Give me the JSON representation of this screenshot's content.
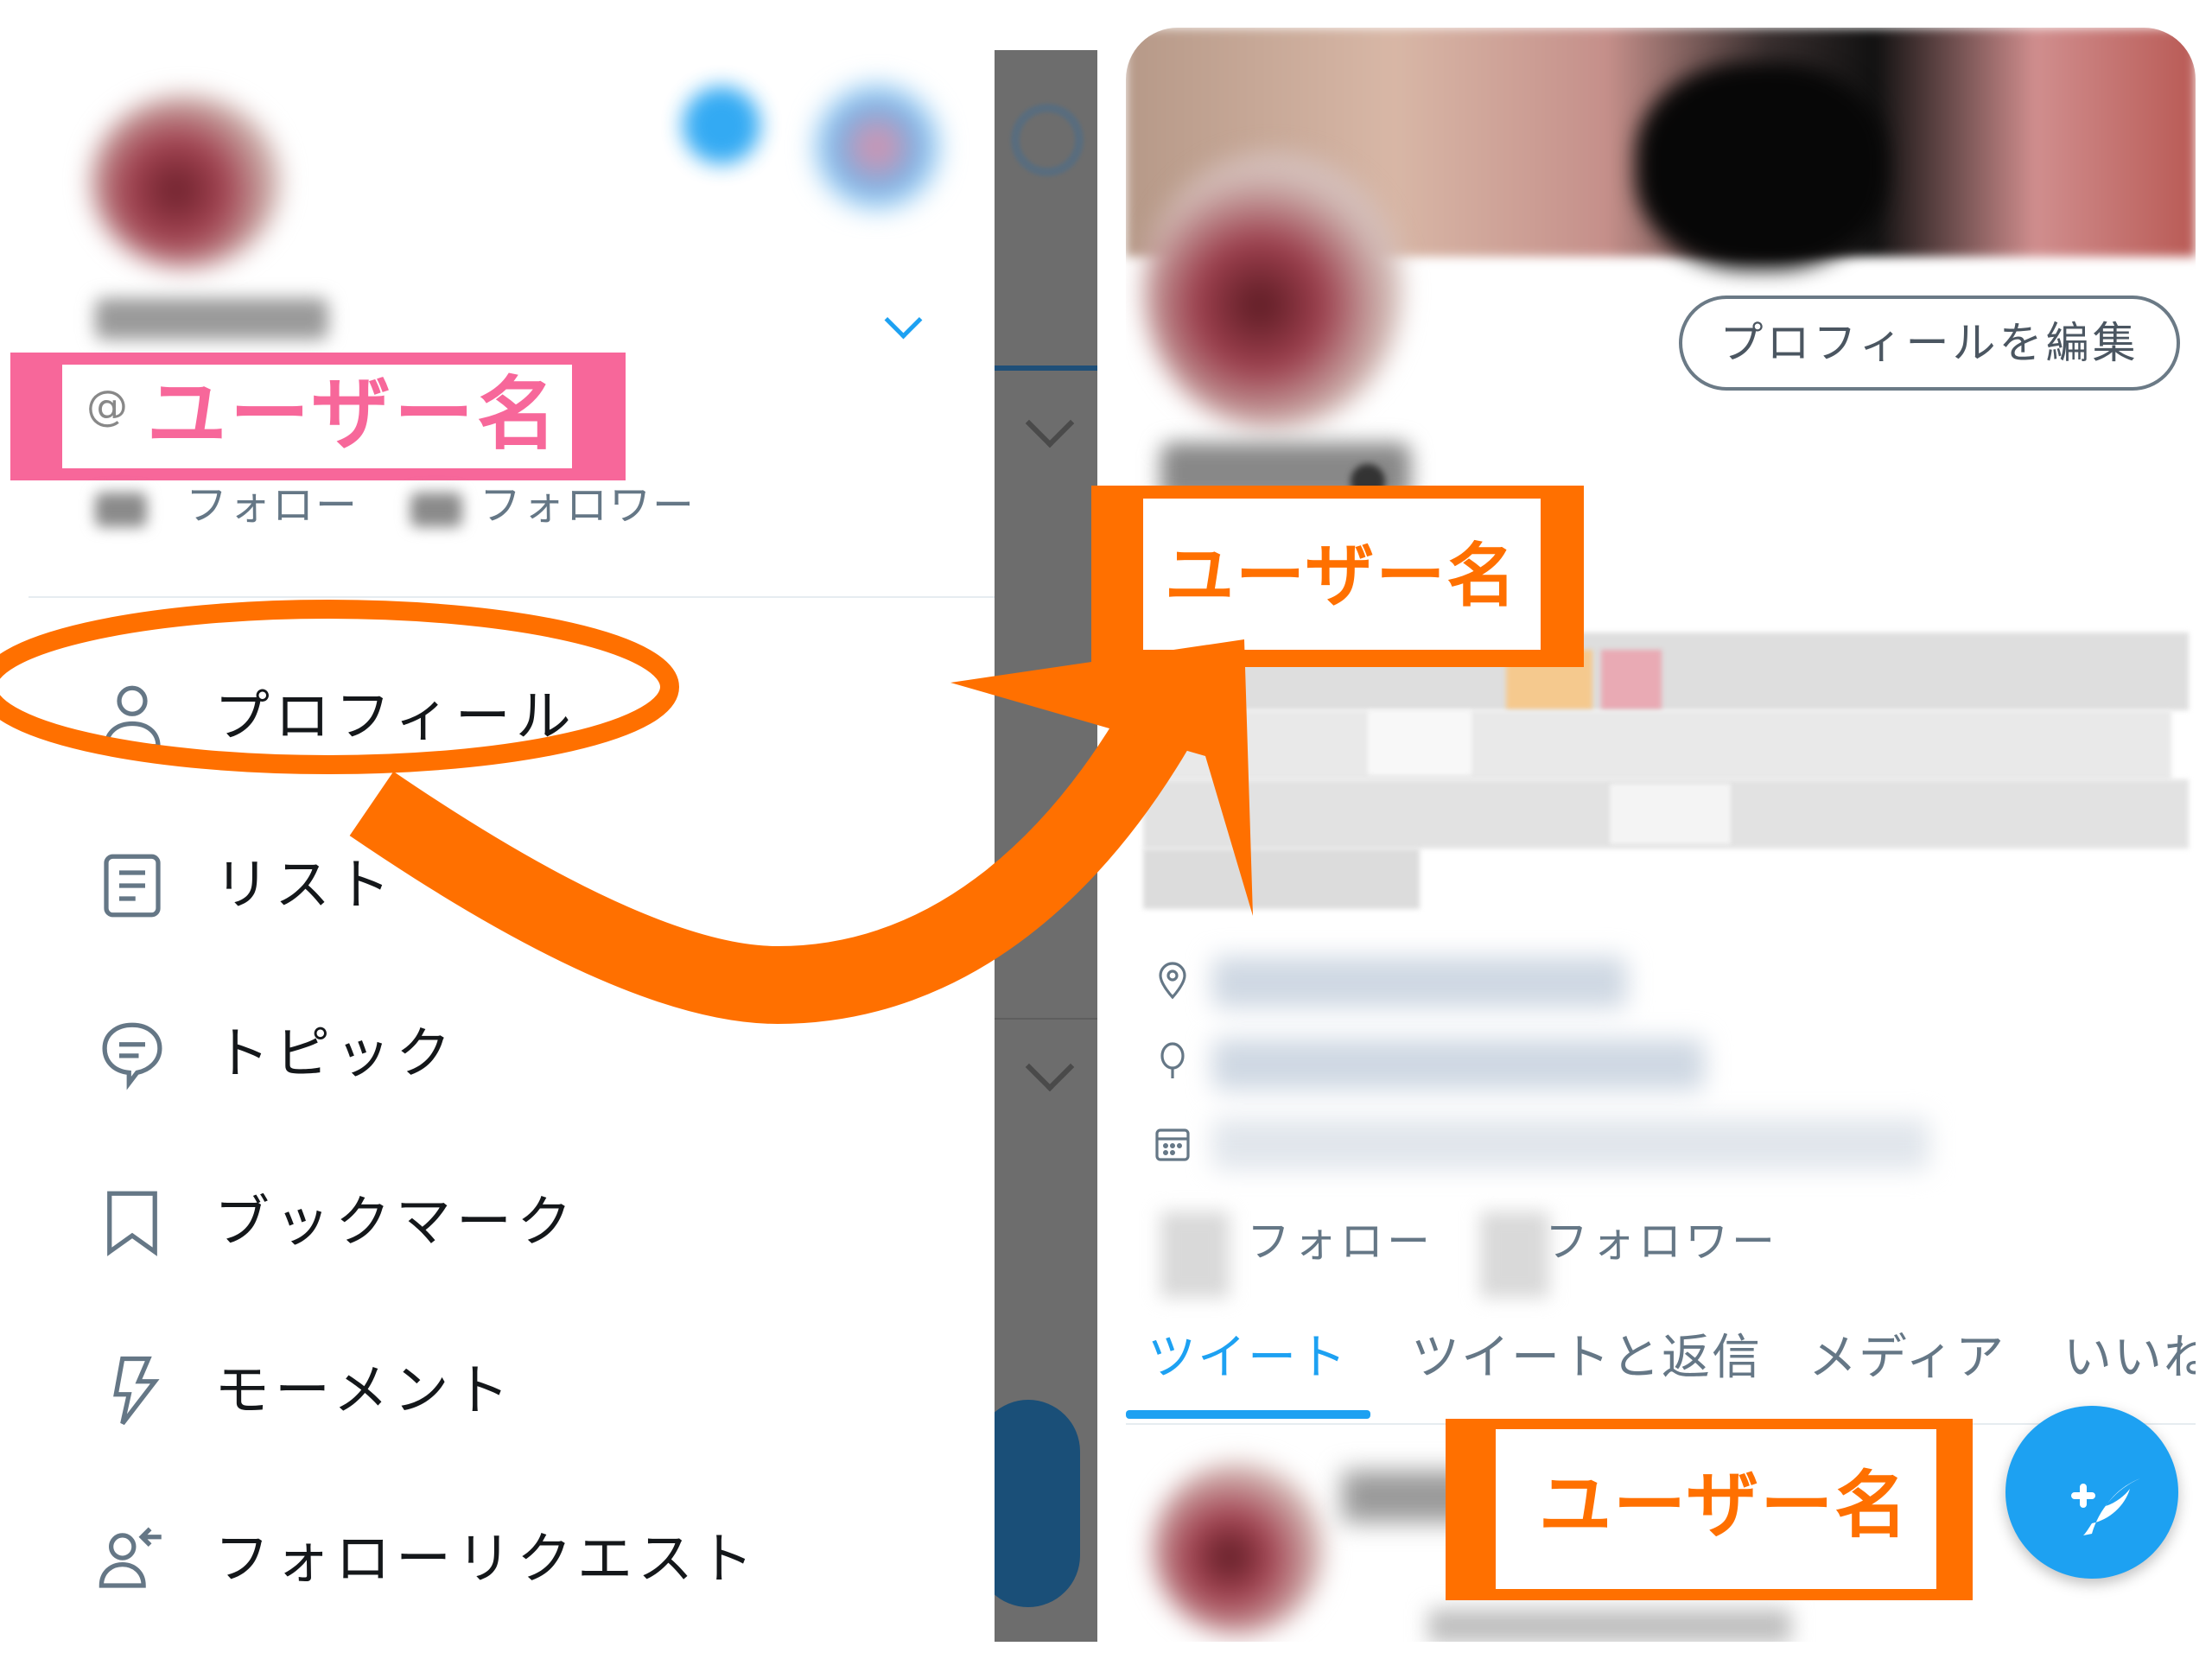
{
  "drawer": {
    "username_label": "ユーザー名",
    "at_sign": "@",
    "following_label": "フォロー",
    "followers_label": "フォロワー",
    "menu": [
      {
        "label": "プロフィール",
        "icon": "person-icon"
      },
      {
        "label": "リスト",
        "icon": "list-icon"
      },
      {
        "label": "トピック",
        "icon": "topic-icon"
      },
      {
        "label": "ブックマーク",
        "icon": "bookmark-icon"
      },
      {
        "label": "モーメント",
        "icon": "lightning-icon"
      },
      {
        "label": "フォローリクエスト",
        "icon": "follow-request-icon"
      }
    ]
  },
  "profile": {
    "edit_button": "プロフィールを編集",
    "username_label": "ユーザー名",
    "following_label": "フォロー",
    "followers_label": "フォロワー",
    "tabs": [
      {
        "label": "ツイート",
        "active": true
      },
      {
        "label": "ツイートと返信",
        "active": false
      },
      {
        "label": "メディア",
        "active": false
      },
      {
        "label": "いいね",
        "active": false
      }
    ],
    "tweet_username_label": "ユーザー名"
  },
  "colors": {
    "accent": "#1da1f2",
    "annotation_orange": "#ff7000",
    "annotation_pink": "#f7679a",
    "secondary_text": "#657786"
  }
}
